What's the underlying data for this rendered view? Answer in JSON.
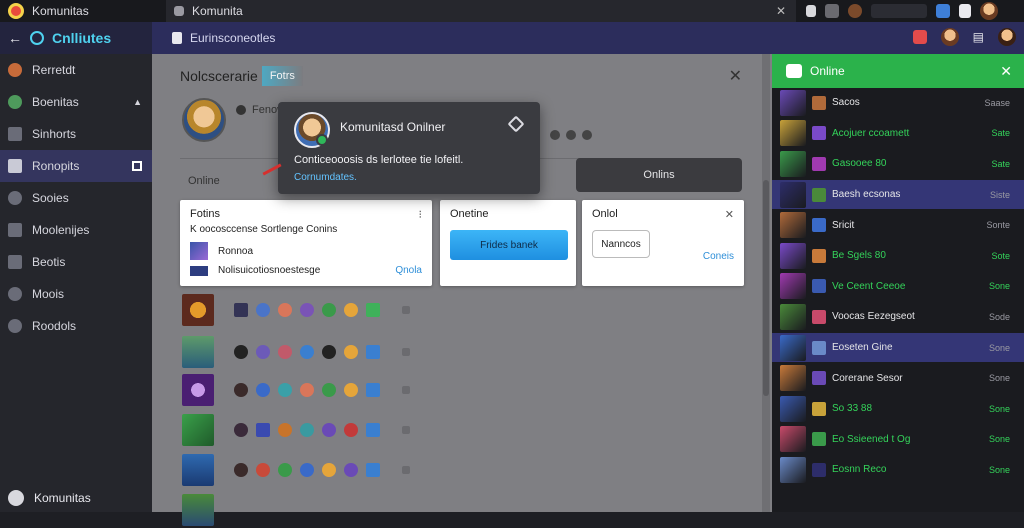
{
  "window": {
    "app_name": "Komunitas",
    "tab_title": "Komunita"
  },
  "navbar": {
    "brand": "Cnlliutes",
    "breadcrumb": "Eurinsconeotles"
  },
  "sidebar": {
    "items": [
      {
        "label": "Rerretdt"
      },
      {
        "label": "Boenitas"
      },
      {
        "label": "Sinhorts"
      },
      {
        "label": "Ronopits"
      },
      {
        "label": "Sooies"
      },
      {
        "label": "Moolenijes"
      },
      {
        "label": "Beotis"
      },
      {
        "label": "Moois"
      },
      {
        "label": "Roodols"
      }
    ],
    "footer": "Komunitas"
  },
  "main": {
    "title": "Nolcscerarie",
    "title_chip": "Fotrs",
    "profile_name": "Fenow",
    "online_label": "Online",
    "online_button": "Onlins",
    "card1": {
      "title": "Fotins",
      "line1": "K  oocosccense Sortlenge Conins",
      "line2": "Ronnoa",
      "line3": "Nolisuicotiosnoestesge",
      "link": "Qnola"
    },
    "card2": {
      "title": "Onetine",
      "button": "Frides banek"
    },
    "card3": {
      "title": "Onlol",
      "button": "Nanncos",
      "link": "Coneis"
    }
  },
  "popup": {
    "title": "Komunitasd Onilner",
    "message": "Conticeooosis ds lerlotee tie lofeitl.",
    "link": "Cornumdates."
  },
  "online_panel": {
    "title": "Online",
    "rows": [
      {
        "name": "Sacos",
        "status": "Saase"
      },
      {
        "name": "Acojuer ccoamett",
        "status": "Sate"
      },
      {
        "name": "Gasooee 80",
        "status": "Sate"
      },
      {
        "name": "Baesh ecsonas",
        "status": "Siste"
      },
      {
        "name": "Sricit",
        "status": "Sonte"
      },
      {
        "name": "Be Sgels 80",
        "status": "Sote"
      },
      {
        "name": "Ve Ceent Ceeoe",
        "status": "Sone"
      },
      {
        "name": "Voocas Eezegseot",
        "status": "Sode"
      },
      {
        "name": "Eoseten Gine",
        "status": "Sone"
      },
      {
        "name": "Corerane Sesor",
        "status": "Sone"
      },
      {
        "name": "So 33 88",
        "status": "Sone"
      },
      {
        "name": "Eo Ssieened t Og",
        "status": "Sone"
      },
      {
        "name": "Eosnn Reco",
        "status": "Sone"
      }
    ]
  },
  "colors": {
    "accent_green": "#2bb24b",
    "nav": "#2c2d5c",
    "link_blue": "#63c3ff"
  }
}
